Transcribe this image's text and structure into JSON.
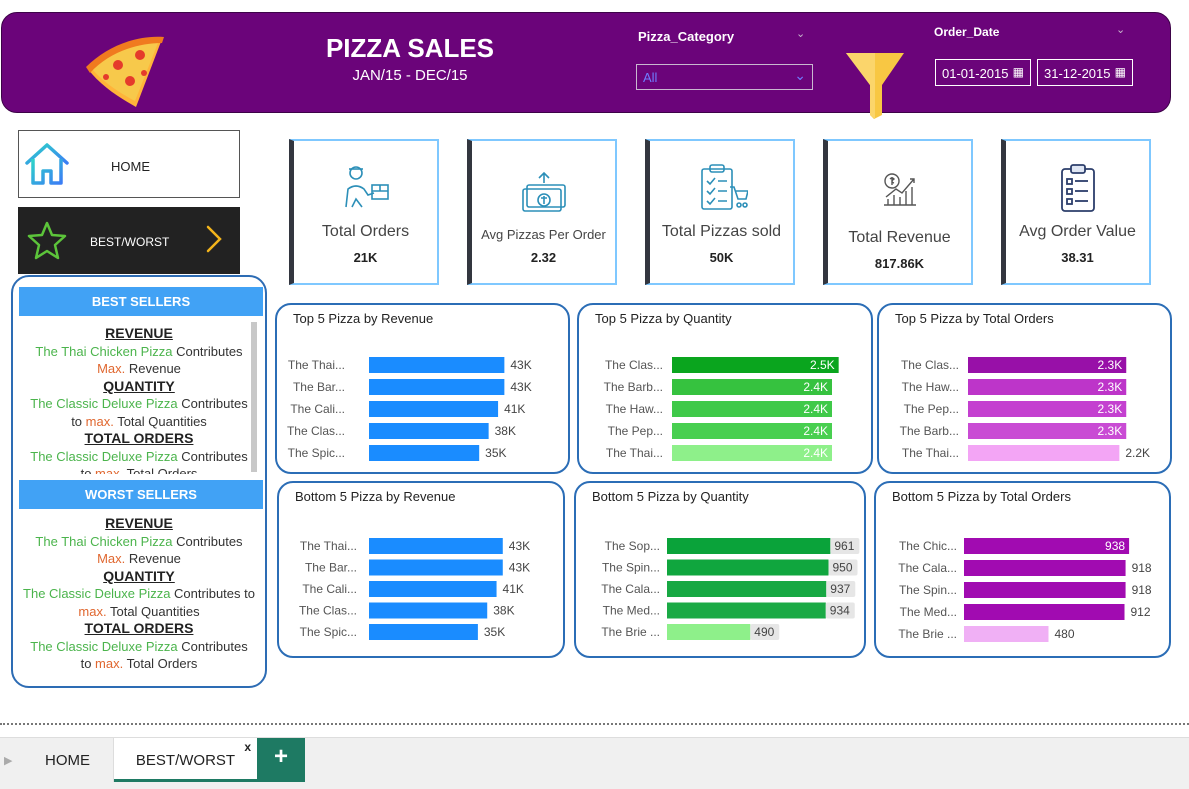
{
  "header": {
    "title": "PIZZA SALES",
    "subtitle": "JAN/15 - DEC/15",
    "category_label": "Pizza_Category",
    "category_value": "All",
    "date_label": "Order_Date",
    "date_from": "01-01-2015",
    "date_to": "31-12-2015",
    "brand_color": "#6b047a"
  },
  "nav": {
    "home_label": "HOME",
    "best_label": "BEST/WORST"
  },
  "sellers": {
    "best_title": "BEST SELLERS",
    "worst_title": "WORST SELLERS",
    "best": {
      "revenue_h": "REVENUE",
      "revenue_pizza": "The Thai Chicken Pizza",
      "revenue_contrib": " Contributes",
      "revenue_max": "Max.",
      "revenue_tail": " Revenue",
      "quantity_h": "QUANTITY",
      "quantity_pizza": "The Classic Deluxe Pizza",
      "quantity_contrib": " Contributes",
      "quantity_pre": "to ",
      "quantity_max": "max.",
      "quantity_tail": "  Total Quantities",
      "orders_h": "TOTAL ORDERS",
      "orders_pizza": "The Classic Deluxe Pizza",
      "orders_contrib": " Contributes",
      "orders_pre": "to ",
      "orders_max": "max.",
      "orders_tail": "  Total Orders"
    },
    "worst": {
      "revenue_h": "REVENUE",
      "revenue_pizza": "The Thai Chicken Pizza",
      "revenue_contrib": " Contributes",
      "revenue_max": "Max.",
      "revenue_tail": " Revenue",
      "quantity_h": "QUANTITY",
      "quantity_pizza": "The Classic Deluxe Pizza",
      "quantity_contrib": " Contributes to",
      "quantity_max": "max.",
      "quantity_tail": "  Total Quantities",
      "orders_h": "TOTAL ORDERS",
      "orders_pizza": "The Classic Deluxe Pizza",
      "orders_contrib": " Contributes",
      "orders_pre": "to ",
      "orders_max": "max.",
      "orders_tail": "  Total Orders"
    }
  },
  "kpis": [
    {
      "label": "Total Orders",
      "value": "21K",
      "icon": "delivery-person-icon"
    },
    {
      "label": "Avg Pizzas Per Order",
      "value": "2.32",
      "icon": "money-upload-icon"
    },
    {
      "label": "Total Pizzas sold",
      "value": "50K",
      "icon": "checklist-cart-icon"
    },
    {
      "label": "Total Revenue",
      "value": "817.86K",
      "icon": "revenue-growth-icon"
    },
    {
      "label": "Avg Order Value",
      "value": "38.31",
      "icon": "clipboard-list-icon"
    }
  ],
  "chart_data": [
    {
      "type": "bar",
      "title": "Top 5 Pizza by Revenue",
      "categories": [
        "The Thai...",
        "The Bar...",
        "The Cali...",
        "The Clas...",
        "The Spic..."
      ],
      "values": [
        43,
        43,
        41,
        38,
        35
      ],
      "labels": [
        "43K",
        "43K",
        "41K",
        "38K",
        "35K"
      ],
      "xlim": [
        0,
        54
      ],
      "color": "#1a8cff",
      "label_inside": false
    },
    {
      "type": "bar",
      "title": "Top 5 Pizza by Quantity",
      "categories": [
        "The Clas...",
        "The Barb...",
        "The Haw...",
        "The Pep...",
        "The Thai..."
      ],
      "values": [
        2.5,
        2.4,
        2.4,
        2.4,
        2.4
      ],
      "labels": [
        "2.5K",
        "2.4K",
        "2.4K",
        "2.4K",
        "2.4K"
      ],
      "xlim": [
        0,
        2.7
      ],
      "colors": [
        "#0aa51e",
        "#36c23f",
        "#3fc949",
        "#48cf50",
        "#8ef08a"
      ],
      "label_inside": true
    },
    {
      "type": "bar",
      "title": "Top 5 Pizza by Total Orders",
      "categories": [
        "The Clas...",
        "The Haw...",
        "The Pep...",
        "The Barb...",
        "The Thai..."
      ],
      "values": [
        2.3,
        2.3,
        2.3,
        2.3,
        2.2
      ],
      "labels": [
        "2.3K",
        "2.3K",
        "2.3K",
        "2.3K",
        "2.2K"
      ],
      "xlim": [
        0,
        2.5
      ],
      "colors": [
        "#9810a8",
        "#bd35c9",
        "#c440d0",
        "#c94bd4",
        "#f3a5f5"
      ],
      "label_inside": [
        true,
        true,
        true,
        true,
        false
      ]
    },
    {
      "type": "bar",
      "title": "Bottom 5 Pizza by Revenue",
      "categories": [
        "The Thai...",
        "The Bar...",
        "The Cali...",
        "The Clas...",
        "The Spic..."
      ],
      "values": [
        43,
        43,
        41,
        38,
        35
      ],
      "labels": [
        "43K",
        "43K",
        "41K",
        "38K",
        "35K"
      ],
      "xlim": [
        0,
        54
      ],
      "color": "#1a8cff",
      "label_inside": false
    },
    {
      "type": "bar",
      "title": "Bottom 5 Pizza by Quantity",
      "categories": [
        "The Sop...",
        "The Spin...",
        "The Cala...",
        "The Med...",
        "The Brie ..."
      ],
      "values": [
        961,
        950,
        937,
        934,
        490
      ],
      "labels": [
        "961",
        "950",
        "937",
        "934",
        "490"
      ],
      "xlim": [
        0,
        1000
      ],
      "colors": [
        "#0aa33a",
        "#10a63e",
        "#17a843",
        "#1aaa45",
        "#8ef08a"
      ],
      "label_inside": false,
      "label_bg": true
    },
    {
      "type": "bar",
      "title": "Bottom 5 Pizza by Total Orders",
      "categories": [
        "The Chic...",
        "The Cala...",
        "The Spin...",
        "The Med...",
        "The Brie ..."
      ],
      "values": [
        938,
        918,
        918,
        912,
        480
      ],
      "labels": [
        "938",
        "918",
        "918",
        "912",
        "480"
      ],
      "xlim": [
        0,
        1000
      ],
      "colors": [
        "#a10bb1",
        "#a10bb1",
        "#a10bb1",
        "#a10bb1",
        "#f0b0f5"
      ],
      "label_inside": [
        true,
        false,
        false,
        false,
        false
      ]
    }
  ],
  "tabs": {
    "home": "HOME",
    "best": "BEST/WORST",
    "close": "x",
    "add": "+"
  }
}
